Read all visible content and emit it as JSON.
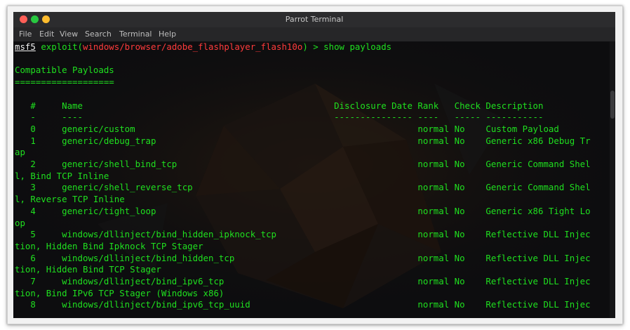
{
  "window": {
    "title": "Parrot Terminal",
    "button_colors": {
      "close": "#ff5f57",
      "minimize": "#28c840",
      "maximize": "#febc2e"
    }
  },
  "menu": [
    "File",
    "Edit",
    "View",
    "Search",
    "Terminal",
    "Help"
  ],
  "prompt": {
    "user": "msf5",
    "verb": "exploit(",
    "module": "windows/browser/adobe_flashplayer_flash10o",
    "rest": ") > show payloads"
  },
  "section_title": "Compatible Payloads",
  "section_underline": "===================",
  "columns": {
    "num": "#",
    "name": "Name",
    "disclosure": "Disclosure Date",
    "rank": "Rank",
    "check": "Check",
    "description": "Description"
  },
  "column_rules": {
    "num": "-",
    "name": "----",
    "disclosure": "---------------",
    "rank": "----",
    "check": "-----",
    "description": "-----------"
  },
  "rows": [
    {
      "num": "0",
      "name": "generic/custom",
      "rank": "normal",
      "check": "No",
      "desc": "Custom Payload",
      "wrap": ""
    },
    {
      "num": "1",
      "name": "generic/debug_trap",
      "rank": "normal",
      "check": "No",
      "desc": "Generic x86 Debug Tr",
      "wrap": "ap"
    },
    {
      "num": "2",
      "name": "generic/shell_bind_tcp",
      "rank": "normal",
      "check": "No",
      "desc": "Generic Command Shel",
      "wrap": "l, Bind TCP Inline"
    },
    {
      "num": "3",
      "name": "generic/shell_reverse_tcp",
      "rank": "normal",
      "check": "No",
      "desc": "Generic Command Shel",
      "wrap": "l, Reverse TCP Inline"
    },
    {
      "num": "4",
      "name": "generic/tight_loop",
      "rank": "normal",
      "check": "No",
      "desc": "Generic x86 Tight Lo",
      "wrap": "op"
    },
    {
      "num": "5",
      "name": "windows/dllinject/bind_hidden_ipknock_tcp",
      "rank": "normal",
      "check": "No",
      "desc": "Reflective DLL Injec",
      "wrap": "tion, Hidden Bind Ipknock TCP Stager"
    },
    {
      "num": "6",
      "name": "windows/dllinject/bind_hidden_tcp",
      "rank": "normal",
      "check": "No",
      "desc": "Reflective DLL Injec",
      "wrap": "tion, Hidden Bind TCP Stager"
    },
    {
      "num": "7",
      "name": "windows/dllinject/bind_ipv6_tcp",
      "rank": "normal",
      "check": "No",
      "desc": "Reflective DLL Injec",
      "wrap": "tion, Bind IPv6 TCP Stager (Windows x86)"
    },
    {
      "num": "8",
      "name": "windows/dllinject/bind_ipv6_tcp_uuid",
      "rank": "normal",
      "check": "No",
      "desc": "Reflective DLL Injec",
      "wrap": ""
    }
  ],
  "colors": {
    "text_green": "#1fe01f",
    "prompt_white": "#f2f2f2",
    "module_red": "#ff3b3b",
    "terminal_bg": "#0d0d0f"
  }
}
